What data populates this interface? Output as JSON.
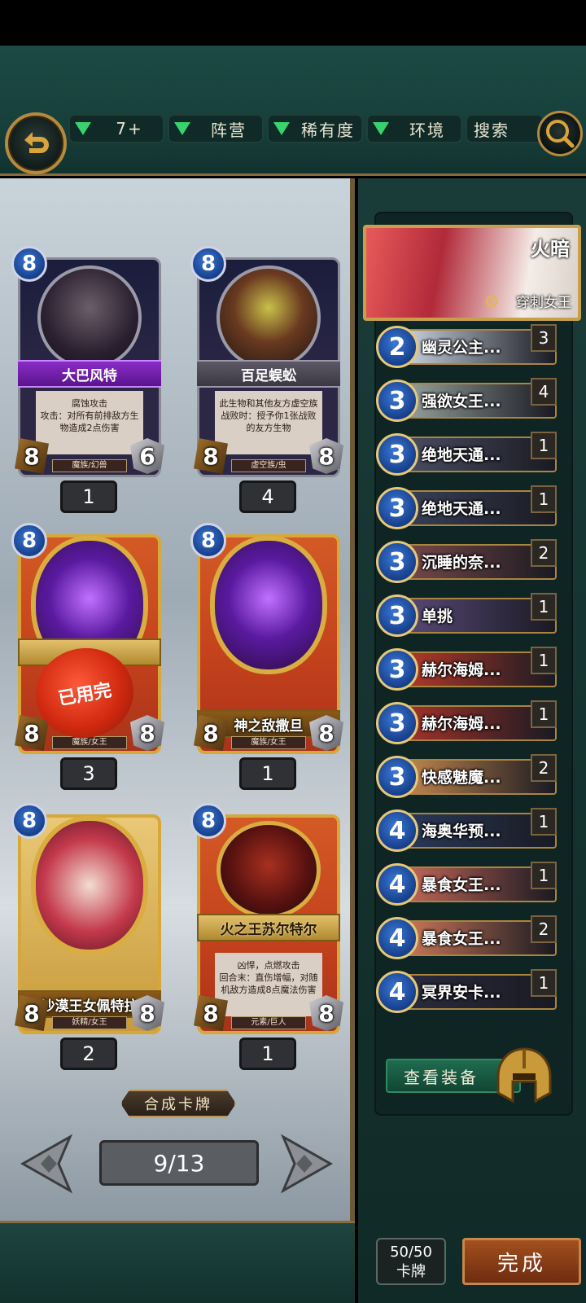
{
  "filters": {
    "cost": "7+",
    "faction": "阵营",
    "rarity": "稀有度",
    "environment": "环境",
    "search": "搜索"
  },
  "cards": [
    {
      "cost": "8",
      "name": "大巴风特",
      "desc": "腐蚀攻击\n攻击：对所有前排敌方生物造成2点伤害",
      "atk": "8",
      "hp": "6",
      "race": "魔族/幻兽",
      "owned": "1"
    },
    {
      "cost": "8",
      "name": "百足蜈蚣",
      "desc": "此生物和其他友方虚空族战败时：授予你1张战败的友方生物",
      "atk": "8",
      "hp": "8",
      "race": "虚空族/虫",
      "owned": "4"
    },
    {
      "cost": "8",
      "name": "",
      "desc": "",
      "atk": "8",
      "hp": "8",
      "race": "魔族/女王",
      "owned": "3",
      "stamp": "已用完"
    },
    {
      "cost": "8",
      "name": "神之敌撒旦",
      "desc": "",
      "atk": "8",
      "hp": "8",
      "race": "魔族/女王",
      "owned": "1"
    },
    {
      "cost": "8",
      "name": "沙漠王女佩特拉",
      "desc": "",
      "atk": "8",
      "hp": "8",
      "race": "妖精/女王",
      "owned": "2"
    },
    {
      "cost": "8",
      "name": "火之王苏尔特尔",
      "desc": "凶悍，点燃攻击\n回合末：直伤增幅，对随机敌方造成8点魔法伤害",
      "atk": "8",
      "hp": "8",
      "race": "元素/巨人",
      "owned": "1"
    }
  ],
  "combine_label": "合成卡牌",
  "page_indicator": "9/13",
  "hero": {
    "element": "火暗",
    "name": "穿刺女王"
  },
  "deck": [
    {
      "cost": "2",
      "name": "幽灵公主...",
      "count": "3",
      "color": "#cfd8e4"
    },
    {
      "cost": "3",
      "name": "强欲女王...",
      "count": "4",
      "color": "#9aa6a0"
    },
    {
      "cost": "3",
      "name": "绝地天通...",
      "count": "1",
      "color": "#4a4f64"
    },
    {
      "cost": "3",
      "name": "绝地天通...",
      "count": "1",
      "color": "#3a4058"
    },
    {
      "cost": "3",
      "name": "沉睡的奈...",
      "count": "2",
      "color": "#7a4a4a"
    },
    {
      "cost": "3",
      "name": "单挑",
      "count": "1",
      "color": "#5a4a7a"
    },
    {
      "cost": "3",
      "name": "赫尔海姆...",
      "count": "1",
      "color": "#b83a2a"
    },
    {
      "cost": "3",
      "name": "赫尔海姆...",
      "count": "1",
      "color": "#a8342a"
    },
    {
      "cost": "3",
      "name": "快感魅魔...",
      "count": "2",
      "color": "#c88a50"
    },
    {
      "cost": "4",
      "name": "海奥华预...",
      "count": "1",
      "color": "#2a3a5a"
    },
    {
      "cost": "4",
      "name": "暴食女王...",
      "count": "1",
      "color": "#c86a5a"
    },
    {
      "cost": "4",
      "name": "暴食女王...",
      "count": "2",
      "color": "#d07a5a"
    },
    {
      "cost": "4",
      "name": "冥界安卡...",
      "count": "1",
      "color": "#2a2c3e"
    }
  ],
  "equip_label": "查看装备",
  "deck_count": {
    "value": "50/50",
    "label": "卡牌"
  },
  "done_label": "完成"
}
